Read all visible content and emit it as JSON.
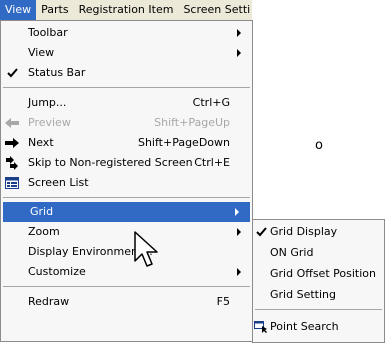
{
  "menubar": {
    "items": [
      "View",
      "Parts",
      "Registration Item",
      "Screen Setti"
    ]
  },
  "view_menu": {
    "toolbar": "Toolbar",
    "view": "View",
    "status_bar": "Status Bar",
    "jump": "Jump...",
    "jump_shortcut": "Ctrl+G",
    "preview": "Preview",
    "preview_shortcut": "Shift+PageUp",
    "next": "Next",
    "next_shortcut": "Shift+PageDown",
    "skip": "Skip to Non-registered Screen",
    "skip_shortcut": "Ctrl+E",
    "screen_list": "Screen List",
    "grid": "Grid",
    "zoom": "Zoom",
    "display_env": "Display Environment...",
    "customize": "Customize",
    "redraw": "Redraw",
    "redraw_shortcut": "F5"
  },
  "grid_submenu": {
    "grid_display": "Grid Display",
    "on_grid": "ON Grid",
    "grid_offset": "Grid Offset Position",
    "grid_setting": "Grid Setting",
    "point_search": "Point Search"
  },
  "background_text": "o",
  "colors": {
    "highlight": "#316ac5",
    "menu_bg": "#f7f7f7",
    "disabled_text": "#a8a8a8"
  }
}
